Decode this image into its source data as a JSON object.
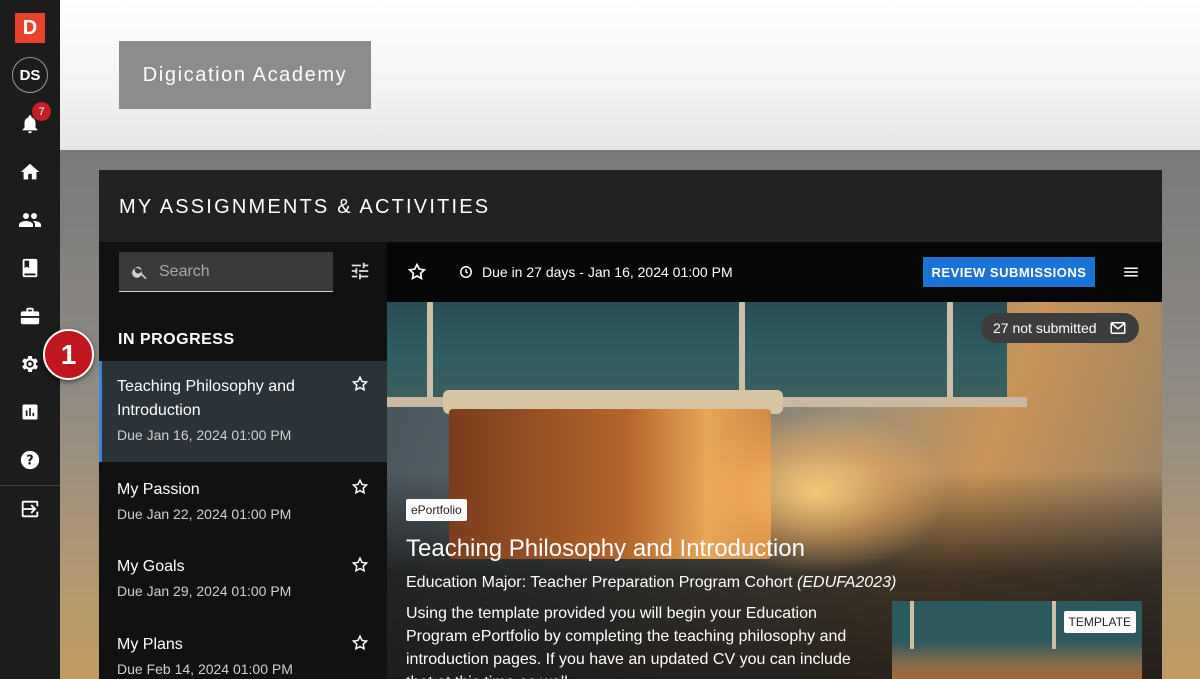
{
  "rail": {
    "logo": "D",
    "avatar_initials": "DS",
    "notification_count": "7",
    "step_marker": "1"
  },
  "site": {
    "name": "Digication Academy"
  },
  "panel": {
    "title": "MY ASSIGNMENTS & ACTIVITIES",
    "search": {
      "placeholder": "Search",
      "value": ""
    },
    "section_label": "IN PROGRESS",
    "items": [
      {
        "title": "Teaching Philosophy and Introduction",
        "due": "Due Jan 16, 2024 01:00 PM",
        "active": true
      },
      {
        "title": "My Passion",
        "due": "Due Jan 22, 2024 01:00 PM",
        "active": false
      },
      {
        "title": "My Goals",
        "due": "Due Jan 29, 2024 01:00 PM",
        "active": false
      },
      {
        "title": "My Plans",
        "due": "Due Feb 14, 2024 01:00 PM",
        "active": false
      }
    ]
  },
  "detail": {
    "due_text": "Due in 27 days - Jan 16, 2024 01:00 PM",
    "review_button": "REVIEW SUBMISSIONS",
    "not_submitted": "27 not submitted",
    "type_tag": "ePortfolio",
    "title": "Teaching Philosophy and Introduction",
    "course": "Education Major: Teacher Preparation Program Cohort",
    "course_code": "(EDUFA2023)",
    "description": "Using the template provided you will begin your Education Program ePortfolio by completing the teaching philosophy and introduction pages. If you have an updated CV you can include that at this time as well.",
    "template_tag": "TEMPLATE"
  }
}
